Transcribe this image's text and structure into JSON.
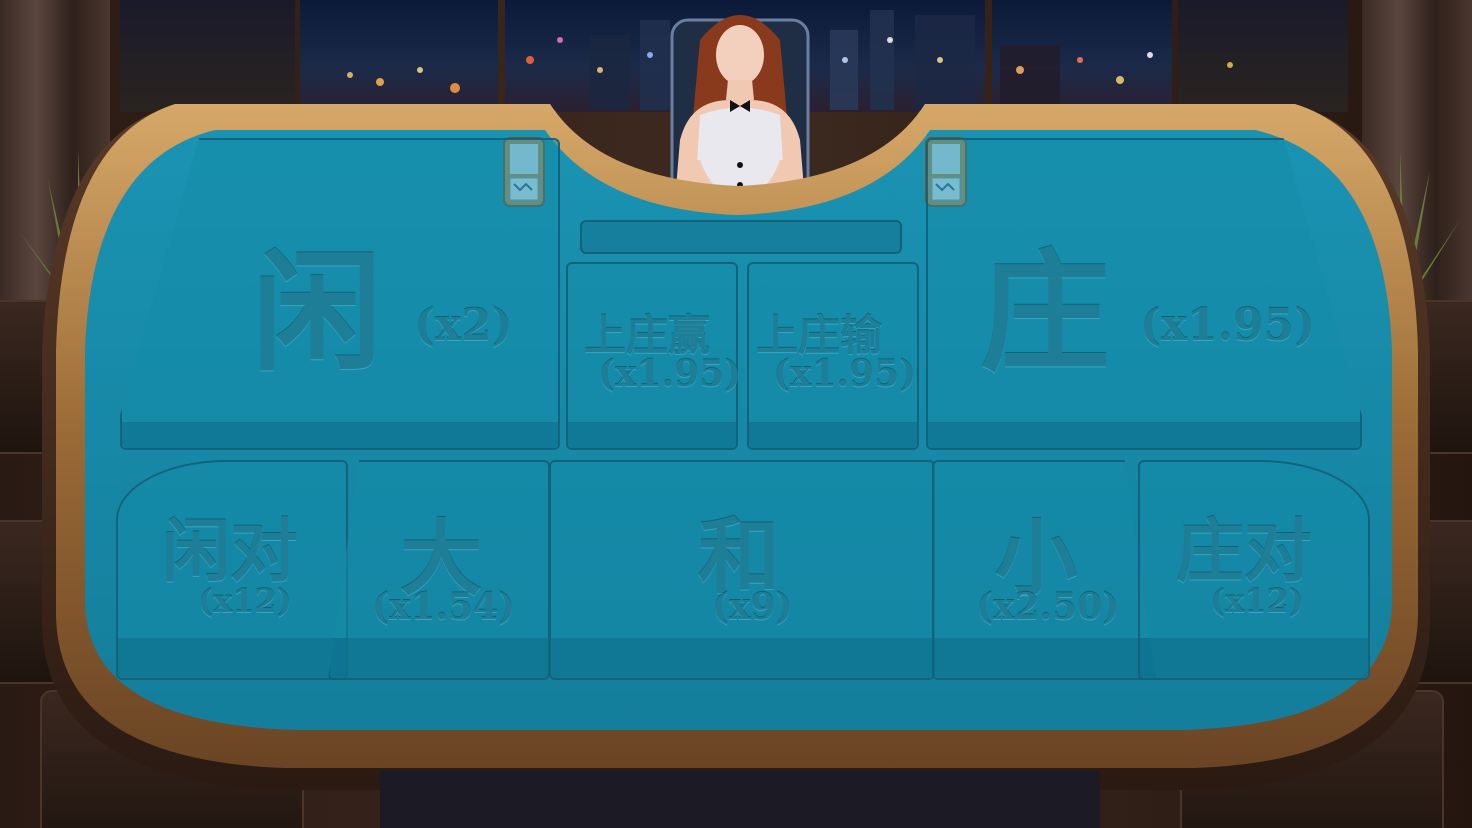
{
  "table": {
    "player": {
      "label": "闲",
      "odds": "(x2)"
    },
    "banker": {
      "label": "庄",
      "odds": "(x1.95)"
    },
    "banker_win": {
      "label": "上庄赢",
      "odds": "(x1.95)"
    },
    "banker_lose": {
      "label": "上庄输",
      "odds": "(x1.95)"
    },
    "player_pair": {
      "label": "闲对",
      "odds": "(x12)"
    },
    "big": {
      "label": "大",
      "odds": "(x1.54)"
    },
    "tie": {
      "label": "和",
      "odds": "(x9)"
    },
    "small": {
      "label": "小",
      "odds": "(x2.50)"
    },
    "banker_pair": {
      "label": "庄对",
      "odds": "(x12)"
    }
  },
  "colors": {
    "felt": "#1a93b2",
    "felt_text": "#1e7e97",
    "rail_gold": "#b98a4e",
    "rail_wood": "#4a2e1e"
  },
  "icons": {
    "left_shoe": "card-shoe-icon",
    "right_shoe": "card-shoe-icon",
    "dealer": "dealer-avatar"
  }
}
